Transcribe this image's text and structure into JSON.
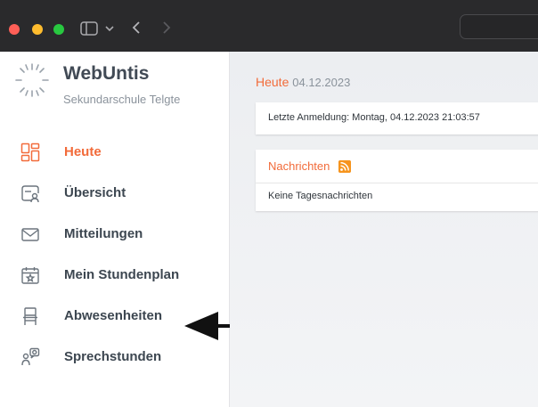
{
  "window": {
    "traffic_lights": [
      "#ff5f57",
      "#febc2e",
      "#28c840"
    ]
  },
  "sidebar": {
    "brand": "WebUntis",
    "school": "Sekundarschule Telgte",
    "items": [
      {
        "label": "Heute",
        "icon": "dashboard-icon",
        "active": true
      },
      {
        "label": "Übersicht",
        "icon": "profile-card-icon",
        "active": false
      },
      {
        "label": "Mitteilungen",
        "icon": "envelope-icon",
        "active": false
      },
      {
        "label": "Mein Stundenplan",
        "icon": "calendar-star-icon",
        "active": false
      },
      {
        "label": "Abwesenheiten",
        "icon": "chair-icon",
        "active": false
      },
      {
        "label": "Sprechstunden",
        "icon": "people-chat-icon",
        "active": false
      }
    ]
  },
  "main": {
    "title": "Heute",
    "date": "04.12.2023",
    "last_login": "Letzte Anmeldung: Montag, 04.12.2023 21:03:57",
    "news": {
      "title": "Nachrichten",
      "icon": "rss-icon",
      "empty_text": "Keine Tagesnachrichten"
    }
  },
  "colors": {
    "accent": "#f26b3a",
    "titlebar": "#2a2a2c",
    "nav_text": "#3c4650"
  },
  "annotation": {
    "icon": "left-arrow-icon"
  }
}
